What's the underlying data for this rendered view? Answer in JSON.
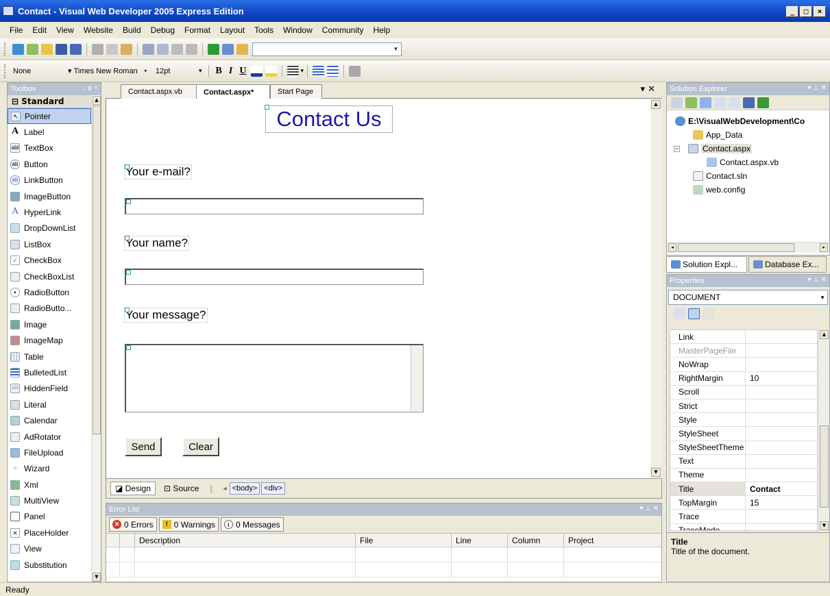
{
  "window": {
    "title": "Contact - Visual Web Developer 2005 Express Edition",
    "btn_min": "_",
    "btn_max": "□",
    "btn_close": "×"
  },
  "menu": [
    "File",
    "Edit",
    "View",
    "Website",
    "Build",
    "Debug",
    "Format",
    "Layout",
    "Tools",
    "Window",
    "Community",
    "Help"
  ],
  "format_toolbar": {
    "block_format": "None",
    "font_name": "Times New Roman",
    "font_size": "12pt",
    "bold": "B",
    "italic": "I",
    "underline": "U"
  },
  "toolbox": {
    "title": "Toolbox",
    "pin": "↓ ѱ ×",
    "section": "Standard",
    "items": [
      "Pointer",
      "Label",
      "TextBox",
      "Button",
      "LinkButton",
      "ImageButton",
      "HyperLink",
      "DropDownList",
      "ListBox",
      "CheckBox",
      "CheckBoxList",
      "RadioButton",
      "RadioButto...",
      "Image",
      "ImageMap",
      "Table",
      "BulletedList",
      "HiddenField",
      "Literal",
      "Calendar",
      "AdRotator",
      "FileUpload",
      "Wizard",
      "Xml",
      "MultiView",
      "Panel",
      "PlaceHolder",
      "View",
      "Substitution"
    ],
    "selected": "Pointer"
  },
  "doc_tabs": [
    "Contact.aspx.vb",
    "Contact.aspx*",
    "Start Page"
  ],
  "active_tab": "Contact.aspx*",
  "design": {
    "heading": "Contact Us",
    "email_label": "Your e-mail?",
    "name_label": "Your name?",
    "message_label": "Your message?",
    "send_button": "Send",
    "clear_button": "Clear"
  },
  "design_footer": {
    "design": "Design",
    "source": "Source",
    "tag1": "<body>",
    "tag2": "<div>"
  },
  "error_list": {
    "title": "Error List",
    "errors": "0 Errors",
    "warnings": "0 Warnings",
    "messages": "0 Messages",
    "columns": [
      "Description",
      "File",
      "Line",
      "Column",
      "Project"
    ]
  },
  "solution_explorer": {
    "title": "Solution Explorer",
    "root": "E:\\VisualWebDevelopment\\Co",
    "nodes": [
      "App_Data",
      "Contact.aspx",
      "Contact.aspx.vb",
      "Contact.sln",
      "web.config"
    ],
    "tabs": [
      "Solution Expl...",
      "Database Ex..."
    ]
  },
  "properties": {
    "title": "Properties",
    "object": "DOCUMENT",
    "rows": [
      {
        "name": "Link",
        "value": ""
      },
      {
        "name": "MasterPageFile",
        "value": ""
      },
      {
        "name": "NoWrap",
        "value": ""
      },
      {
        "name": "RightMargin",
        "value": "10"
      },
      {
        "name": "Scroll",
        "value": ""
      },
      {
        "name": "Strict",
        "value": ""
      },
      {
        "name": "Style",
        "value": ""
      },
      {
        "name": "StyleSheet",
        "value": ""
      },
      {
        "name": "StyleSheetTheme",
        "value": ""
      },
      {
        "name": "Text",
        "value": ""
      },
      {
        "name": "Theme",
        "value": ""
      },
      {
        "name": "Title",
        "value": "Contact"
      },
      {
        "name": "TopMargin",
        "value": "15"
      },
      {
        "name": "Trace",
        "value": ""
      },
      {
        "name": "TraceMode",
        "value": ""
      }
    ],
    "desc_title": "Title",
    "desc_text": "Title of the document."
  },
  "status": "Ready",
  "colors": {
    "titlebar": "#1046c4",
    "heading_blue": "#1a1aa8",
    "panel_header": "#b7c0cf"
  }
}
